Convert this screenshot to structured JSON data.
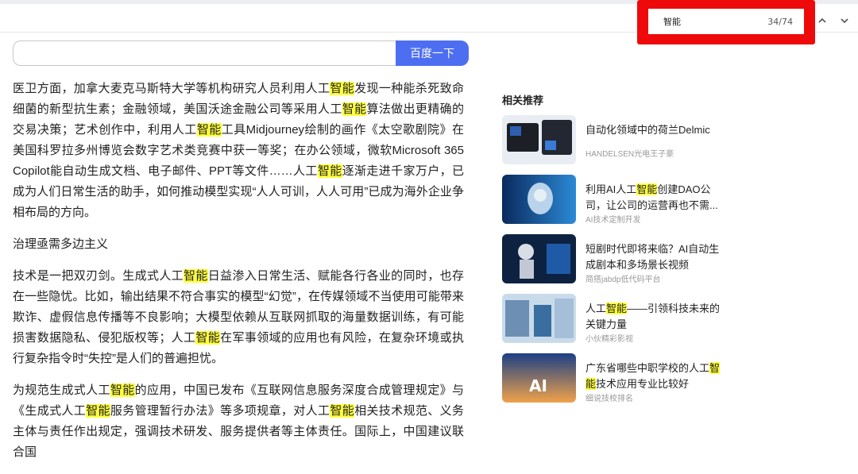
{
  "findbar": {
    "query": "智能",
    "count": "34/74",
    "up_icon": "chevron-up-icon",
    "down_icon": "chevron-down-icon",
    "highlight_color": "#ee0a0a"
  },
  "search": {
    "value": "",
    "button_label": "百度一下",
    "button_color": "#4e6ef2"
  },
  "highlight": {
    "word": "智能",
    "color": "#ffff3e"
  },
  "article": {
    "p1": [
      "医卫方面，加拿大麦克马斯特大学等机构研究人员利用人工",
      "智能",
      "发现一种能杀死致命细菌的新型抗生素；金融领域，美国沃途金融公司等采用人工",
      "智能",
      "算法做出更精确的交易决策；艺术创作中，利用人工",
      "智能",
      "工具Midjourney绘制的画作《太空歌剧院》在美国科罗拉多州博览会数字艺术类竞赛中获一等奖；在办公领域，微软Microsoft 365 Copilot能自动生成文档、电子邮件、PPT等文件……人工",
      "智能",
      "逐渐走进千家万户，已成为人们日常生活的助手，如何推动模型实现“人人可训，人人可用”已成为海外企业争相布局的方向。"
    ],
    "section_heading": "治理亟需多边主义",
    "p2": [
      "技术是一把双刃剑。生成式人工",
      "智能",
      "日益渗入日常生活、赋能各行各业的同时，也存在一些隐忧。比如，输出结果不符合事实的模型“幻觉”，在传媒领域不当使用可能带来欺诈、虚假信息传播等不良影响；大模型依赖从互联网抓取的海量数据训练，有可能损害数据隐私、侵犯版权等；人工",
      "智能",
      "在军事领域的应用也有风险，在复杂环境或执行复杂指令时“失控”是人们的普遍担忧。"
    ],
    "p3": [
      "为规范生成式人工",
      "智能",
      "的应用，中国已发布《互联网信息服务深度合成管理规定》与《生成式人工",
      "智能",
      "服务管理暂行办法》等多项规章，对人工",
      "智能",
      "相关技术规范、义务主体与责任作出规定，强调技术研发、服务提供者等主体责任。国际上，中国建议联合国"
    ]
  },
  "sidebar": {
    "title": "相关推荐",
    "items": [
      {
        "title": [
          "自动化领域中的荷兰Delmic"
        ],
        "source": "HANDELSEN光电王子豪"
      },
      {
        "title": [
          "利用AI人工",
          "智能",
          "创建DAO公司，让公司的运营再也不需..."
        ],
        "source": "AI技术定制开发"
      },
      {
        "title": [
          "短剧时代即将来临？AI自动生成剧本和多场景长视频"
        ],
        "source": "简搭jabdp低代码平台"
      },
      {
        "title": [
          "人工",
          "智能",
          "——引领科技未来的关键力量"
        ],
        "source": "小伙精彩影视"
      },
      {
        "title": [
          "广东省哪些中职学校的人工",
          "智",
          "能",
          "技术应用专业比较好"
        ],
        "source": "细说技校排名"
      }
    ]
  }
}
